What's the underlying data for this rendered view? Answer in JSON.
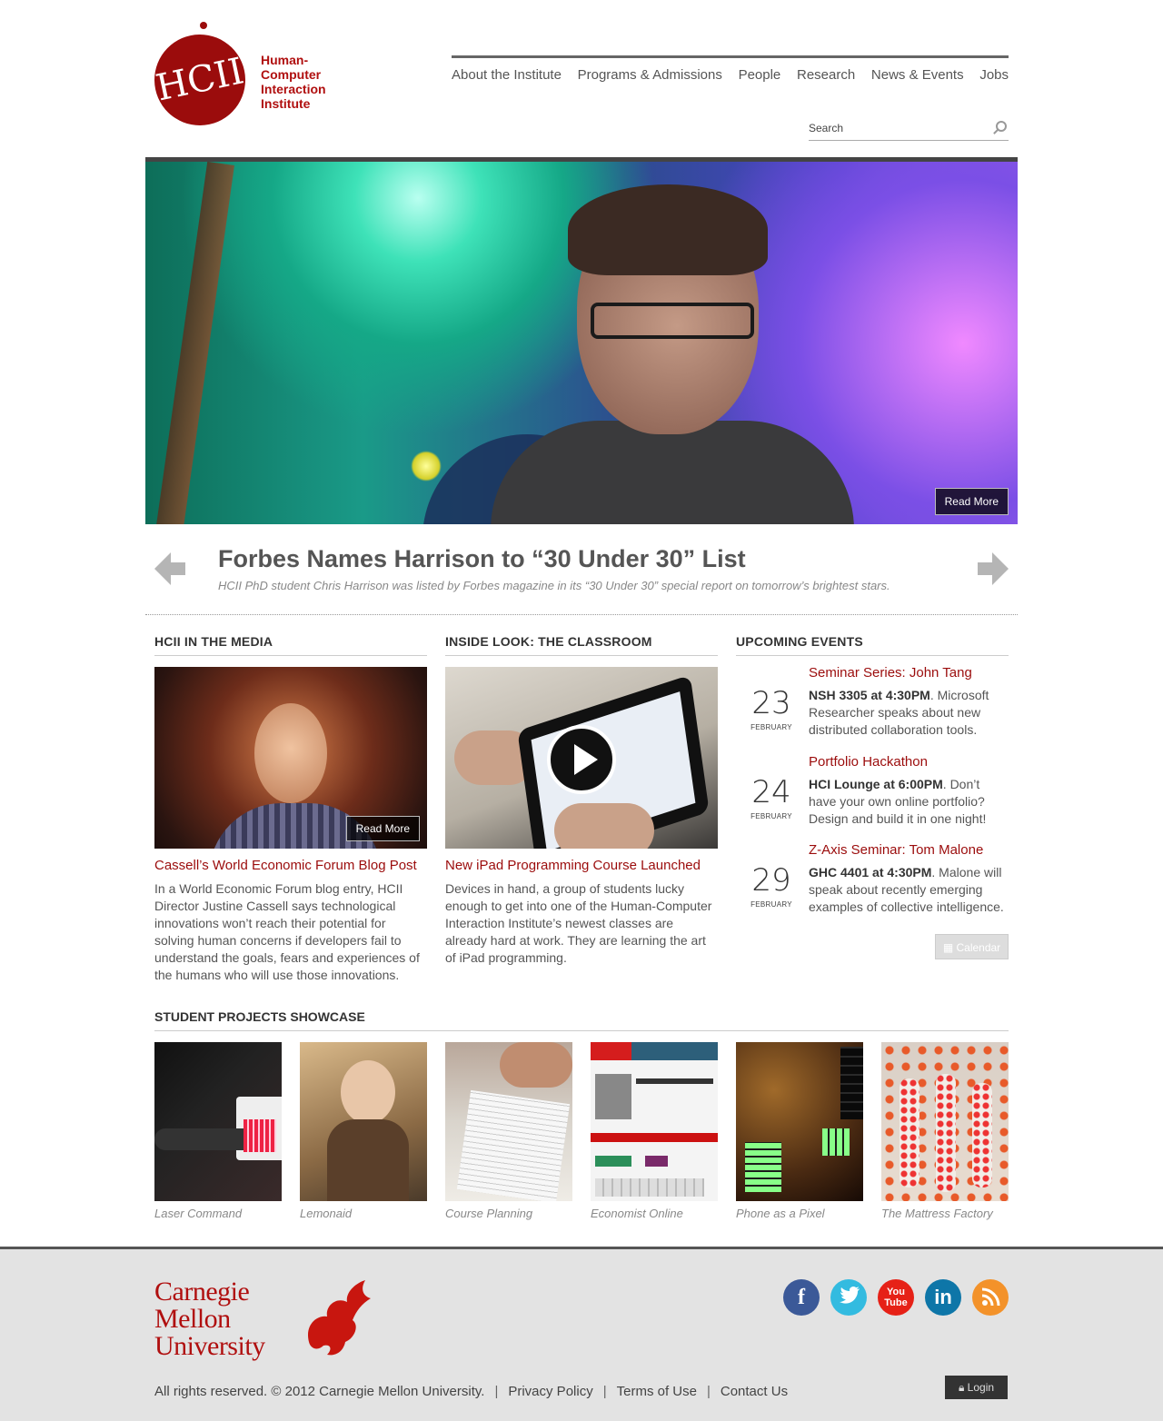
{
  "logo": {
    "text": "HCII",
    "institute_name": "Human-Computer Interaction Institute"
  },
  "nav": [
    "About the Institute",
    "Programs & Admissions",
    "People",
    "Research",
    "News & Events",
    "Jobs"
  ],
  "search": {
    "placeholder": "Search"
  },
  "hero": {
    "read_more": "Read More"
  },
  "headline": {
    "title": "Forbes Names Harrison to “30 Under 30” List",
    "subtitle": "HCII PhD student Chris Harrison was listed by Forbes magazine in its “30 Under 30” special report on tomorrow’s brightest stars."
  },
  "media": {
    "heading": "HCII IN THE MEDIA",
    "read_more": "Read More",
    "link": "Cassell’s World Economic Forum Blog Post",
    "body": "In a World Economic Forum blog entry, HCII Director Justine Cassell says technological innovations won’t reach their potential for solving human concerns if developers fail to understand the goals, fears and experiences of the humans who will use those innovations."
  },
  "classroom": {
    "heading": "INSIDE LOOK: THE CLASSROOM",
    "link": "New iPad Programming Course Launched",
    "body": "Devices in hand, a group of students lucky enough to get into one of the Human-Computer Interaction Institute’s newest classes are already hard at work. They are learning the art of iPad programming."
  },
  "events": {
    "heading": "UPCOMING EVENTS",
    "items": [
      {
        "day": "23",
        "month": "FEBRUARY",
        "title": "Seminar Series: John Tang",
        "where": "NSH 3305 at 4:30PM",
        "desc": ". Microsoft Researcher speaks about new distributed collaboration tools."
      },
      {
        "day": "24",
        "month": "FEBRUARY",
        "title": "Portfolio Hackathon",
        "where": "HCI Lounge at 6:00PM",
        "desc": ". Don’t have your own online portfolio? Design and build it in one night!"
      },
      {
        "day": "29",
        "month": "FEBRUARY",
        "title": "Z-Axis Seminar: Tom Malone",
        "where": "GHC 4401 at 4:30PM",
        "desc": ". Malone will speak about recently emerging examples of collective intelligence."
      }
    ],
    "calendar_button": "Calendar"
  },
  "showcase": {
    "heading": "STUDENT PROJECTS SHOWCASE",
    "projects": [
      "Laser Command",
      "Lemonaid",
      "Course Planning",
      "Economist Online",
      "Phone as a Pixel",
      "The Mattress Factory"
    ]
  },
  "footer": {
    "cmu_lines": [
      "Carnegie",
      "Mellon",
      "University"
    ],
    "social": [
      "facebook-icon",
      "twitter-icon",
      "youtube-icon",
      "linkedin-icon",
      "rss-icon"
    ],
    "youtube_text": "You Tube",
    "linkedin_text": "in",
    "facebook_text": "f",
    "copyright": "All rights reserved. © 2012 Carnegie Mellon University.",
    "links": [
      "Privacy Policy",
      "Terms of Use",
      "Contact Us"
    ],
    "login": "Login"
  },
  "colors": {
    "brand_red": "#9b0c0c",
    "facebook": "#3b5998",
    "twitter": "#33bbe0",
    "youtube": "#e62117",
    "linkedin": "#0e76a8",
    "rss": "#f3922a"
  }
}
